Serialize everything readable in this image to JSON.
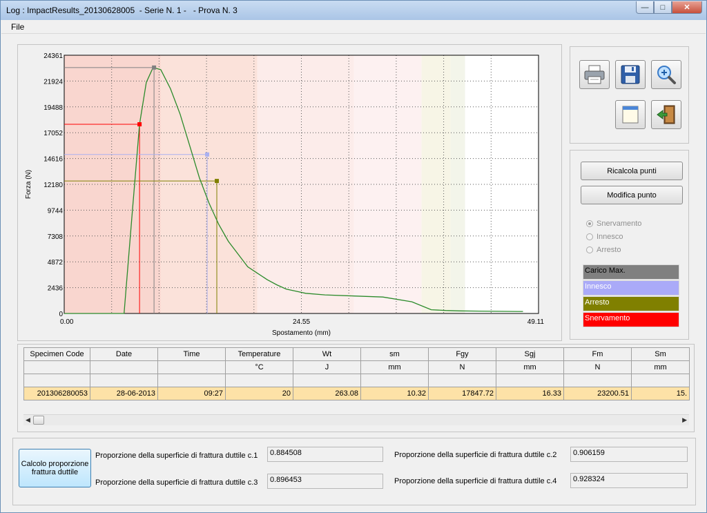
{
  "window": {
    "title": "Log : ImpactResults_20130628005  - Serie N. 1 -   - Prova N. 3",
    "title_badge": "ImpactResults"
  },
  "menu": {
    "file": "File"
  },
  "chart_data": {
    "type": "line",
    "xlabel": "Spostamento (mm)",
    "ylabel": "Forza (N)",
    "xlim": [
      0,
      49.11
    ],
    "ylim": [
      0,
      24361
    ],
    "x_ticks": [
      "0.00",
      "24.55",
      "49.11"
    ],
    "y_ticks": [
      "0",
      "2436",
      "4872",
      "7308",
      "9744",
      "12180",
      "14616",
      "17052",
      "19488",
      "21924",
      "24361"
    ],
    "grid": true,
    "x": [
      0,
      6.2,
      7.0,
      7.8,
      8.5,
      9.2,
      10.0,
      11.0,
      12.0,
      13.0,
      14.0,
      15.0,
      16.0,
      17.0,
      18.0,
      19.0,
      20.0,
      21.0,
      22.0,
      23.0,
      24.0,
      25.0,
      27.0,
      30.0,
      33.0,
      36.0,
      38.0,
      39.5,
      41.0,
      43.0,
      45.0,
      47.0,
      47.5
    ],
    "y": [
      0,
      0,
      9000,
      17847,
      21800,
      23200,
      23000,
      21200,
      18800,
      15800,
      12800,
      10400,
      8400,
      6800,
      5600,
      4400,
      3800,
      3200,
      2700,
      2300,
      2100,
      1900,
      1750,
      1650,
      1550,
      1100,
      350,
      280,
      240,
      220,
      200,
      190,
      190
    ],
    "markers": [
      {
        "name": "Snervamento",
        "x": 7.8,
        "y": 17847,
        "color": "#ff0000"
      },
      {
        "name": "Carico Max.",
        "x": 9.3,
        "y": 23200,
        "color": "#808080"
      },
      {
        "name": "Innesco",
        "x": 14.8,
        "y": 15000,
        "color": "#aab0f0"
      },
      {
        "name": "Arresto",
        "x": 15.8,
        "y": 12500,
        "color": "#808000"
      }
    ],
    "line_color": "#2a8a2a",
    "bands": [
      {
        "from": 0,
        "to": 10,
        "color": "#f9d6cf"
      },
      {
        "from": 10,
        "to": 20,
        "color": "#fbe2da"
      },
      {
        "from": 20,
        "to": 30,
        "color": "#fcecea"
      },
      {
        "from": 30,
        "to": 37,
        "color": "#fdf1f1"
      },
      {
        "from": 37,
        "to": 40,
        "color": "#f7f5e6"
      },
      {
        "from": 40,
        "to": 41.5,
        "color": "#f3f5ea"
      }
    ]
  },
  "side": {
    "ricalcola": "Ricalcola punti",
    "modifica": "Modifica punto",
    "radios": [
      "Snervamento",
      "Innesco",
      "Arresto"
    ],
    "legend": [
      {
        "label": "Carico Max.",
        "color": "#808080",
        "text": "#000000"
      },
      {
        "label": "Innesco",
        "color": "#aaaaf8",
        "text": "#ffffff"
      },
      {
        "label": "Arresto",
        "color": "#808000",
        "text": "#ffffff"
      },
      {
        "label": "Snervamento",
        "color": "#ff0000",
        "text": "#ffffff"
      }
    ]
  },
  "table": {
    "headers": [
      "Specimen Code",
      "Date",
      "Time",
      "Temperature",
      "Wt",
      "sm",
      "Fgy",
      "Sgj",
      "Fm",
      "Sm"
    ],
    "units": [
      "",
      "",
      "",
      "°C",
      "J",
      "mm",
      "N",
      "mm",
      "N",
      "mm"
    ],
    "row": [
      "201306280053",
      "28-06-2013",
      "09:27",
      "20",
      "263.08",
      "10.32",
      "17847.72",
      "16.33",
      "23200.51",
      "15."
    ]
  },
  "bottom": {
    "calc_button": "Calcolo proporzione frattura duttile",
    "labels": [
      "Proporzione della superficie di  frattura duttile c.1",
      "Proporzione della superficie di  frattura duttile c.2",
      "Proporzione della superficie di  frattura duttile c.3",
      "Proporzione della superficie di  frattura duttile c.4"
    ],
    "values": [
      "0.884508",
      "0.906159",
      "0.896453",
      "0.928324"
    ]
  }
}
